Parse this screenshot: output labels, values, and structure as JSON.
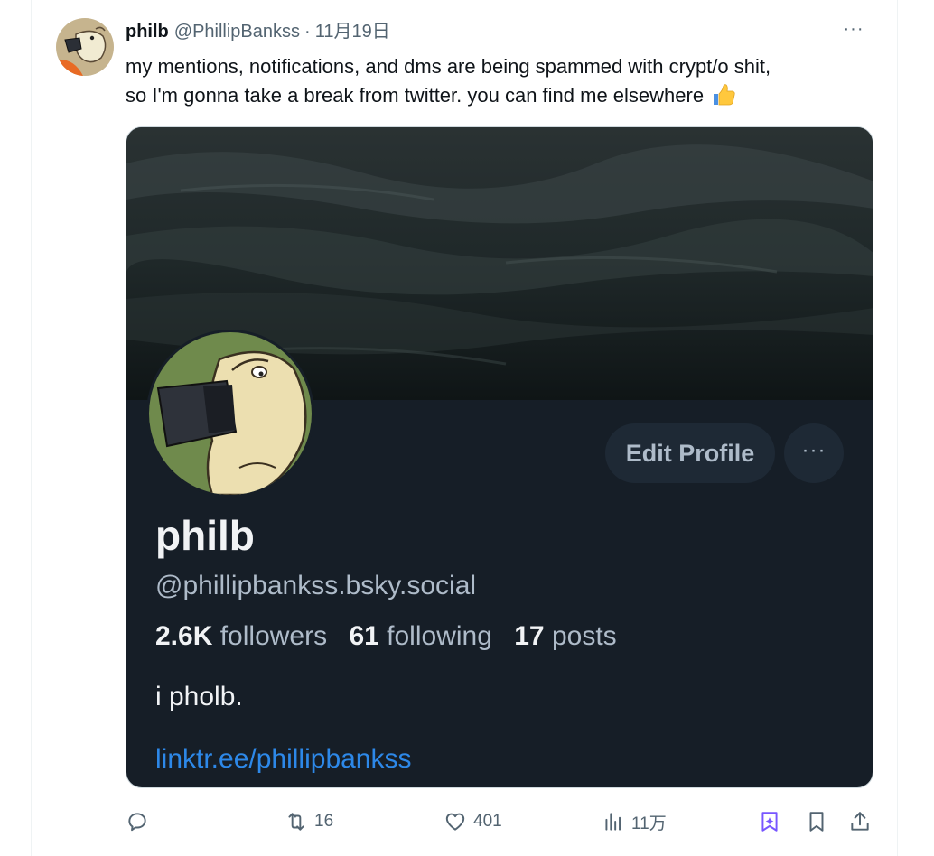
{
  "tweet": {
    "author_name": "philb",
    "author_handle": "@PhillipBankss",
    "separator": "·",
    "date": "11月19日",
    "more_label": "···",
    "text_line1": "my mentions, notifications, and dms are being spammed with crypt/o shit,",
    "text_line2": "so I'm gonna take a break from twitter. you can find me elsewhere"
  },
  "profile_card": {
    "name": "philb",
    "handle": "@phillipbankss.bsky.social",
    "followers_count": "2.6K",
    "followers_label": "followers",
    "following_count": "61",
    "following_label": "following",
    "posts_count": "17",
    "posts_label": "posts",
    "bio": "i pholb.",
    "link": "linktr.ee/phillipbankss",
    "edit_button": "Edit Profile",
    "more_button": "···"
  },
  "actions": {
    "reply_count": "",
    "retweet_count": "16",
    "like_count": "401",
    "views_count": "11万"
  },
  "icons": {
    "reply": "reply-icon",
    "retweet": "retweet-icon",
    "like": "heart-icon",
    "views": "views-icon",
    "grok": "grok-icon",
    "bookmark": "bookmark-icon",
    "share": "share-icon"
  },
  "colors": {
    "text_primary": "#0f1419",
    "text_secondary": "#536471",
    "card_bg": "#161e27",
    "card_link": "#2d88e8",
    "grok_accent": "#7856ff"
  }
}
